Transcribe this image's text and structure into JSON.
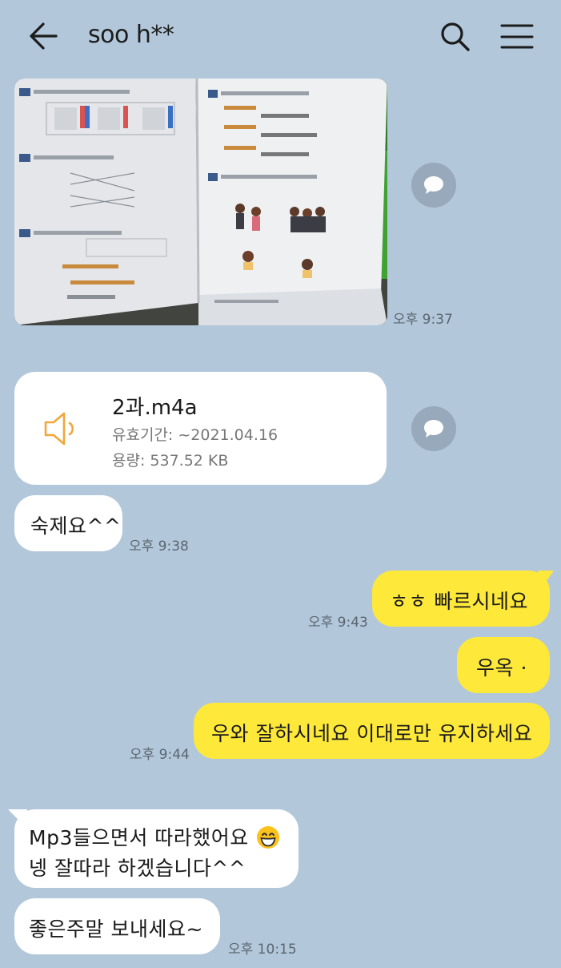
{
  "header": {
    "title": "soo h**"
  },
  "messages": {
    "photo": {
      "time": "오후 9:37"
    },
    "file": {
      "name": "2과.m4a",
      "expiry": "유효기간: ~2021.04.16",
      "size": "용량: 537.52 KB"
    },
    "m1": {
      "text": "숙제요^^",
      "time": "오후 9:38"
    },
    "m2": {
      "text": "ㅎㅎ 빠르시네요",
      "time": "오후 9:43"
    },
    "m3": {
      "text": "우옥 ·"
    },
    "m4": {
      "text": "우와 잘하시네요 이대로만 유지하세요",
      "time": "오후 9:44"
    },
    "m5": {
      "line1": "Mp3들으면서 따라했어요",
      "line2": "넹 잘따라 하겠습니다^^"
    },
    "m6": {
      "text": "좋은주말 보내세요~",
      "time": "오후 10:15"
    }
  },
  "colors": {
    "background": "#b2c7da",
    "my_bubble": "#fee83a",
    "their_bubble": "#ffffff",
    "share_button": "#97a9ba"
  },
  "icons": {
    "back": "arrow-left",
    "search": "magnifier",
    "menu": "hamburger",
    "share": "speech-bubble",
    "file": "speaker",
    "emoji": "grinning-face"
  }
}
